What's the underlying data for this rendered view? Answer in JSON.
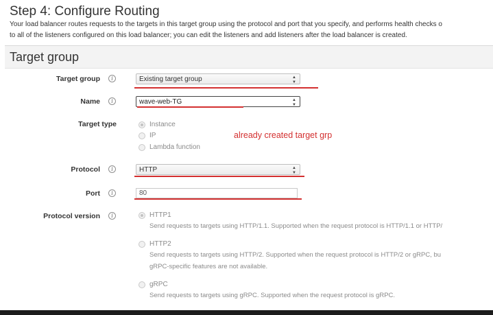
{
  "header": {
    "step_title": "Step 4: Configure Routing",
    "intro_line1": "Your load balancer routes requests to the targets in this target group using the protocol and port that you specify, and performs health checks o",
    "intro_line2": "to all of the listeners configured on this load balancer; you can edit the listeners and add listeners after the load balancer is created."
  },
  "section": {
    "title": "Target group"
  },
  "form": {
    "target_group": {
      "label": "Target group",
      "value": "Existing target group"
    },
    "name": {
      "label": "Name",
      "value": "wave-web-TG"
    },
    "target_type": {
      "label": "Target type",
      "options": [
        "Instance",
        "IP",
        "Lambda function"
      ],
      "selected": "Instance"
    },
    "protocol": {
      "label": "Protocol",
      "value": "HTTP"
    },
    "port": {
      "label": "Port",
      "value": "80"
    },
    "protocol_version": {
      "label": "Protocol version",
      "options": [
        {
          "label": "HTTP1",
          "desc": [
            "Send requests to targets using HTTP/1.1. Supported when the request protocol is HTTP/1.1 or HTTP/"
          ]
        },
        {
          "label": "HTTP2",
          "desc": [
            "Send requests to targets using HTTP/2. Supported when the request protocol is HTTP/2 or gRPC, bu",
            "gRPC-specific features are not available."
          ]
        },
        {
          "label": "gRPC",
          "desc": [
            "Send requests to targets using gRPC. Supported when the request protocol is gRPC."
          ]
        }
      ],
      "selected": "HTTP1"
    }
  },
  "annotation": {
    "text": "already created target grp",
    "color": "#d32f2f"
  },
  "icons": {
    "info": "i",
    "select_caret": "▲▼"
  }
}
